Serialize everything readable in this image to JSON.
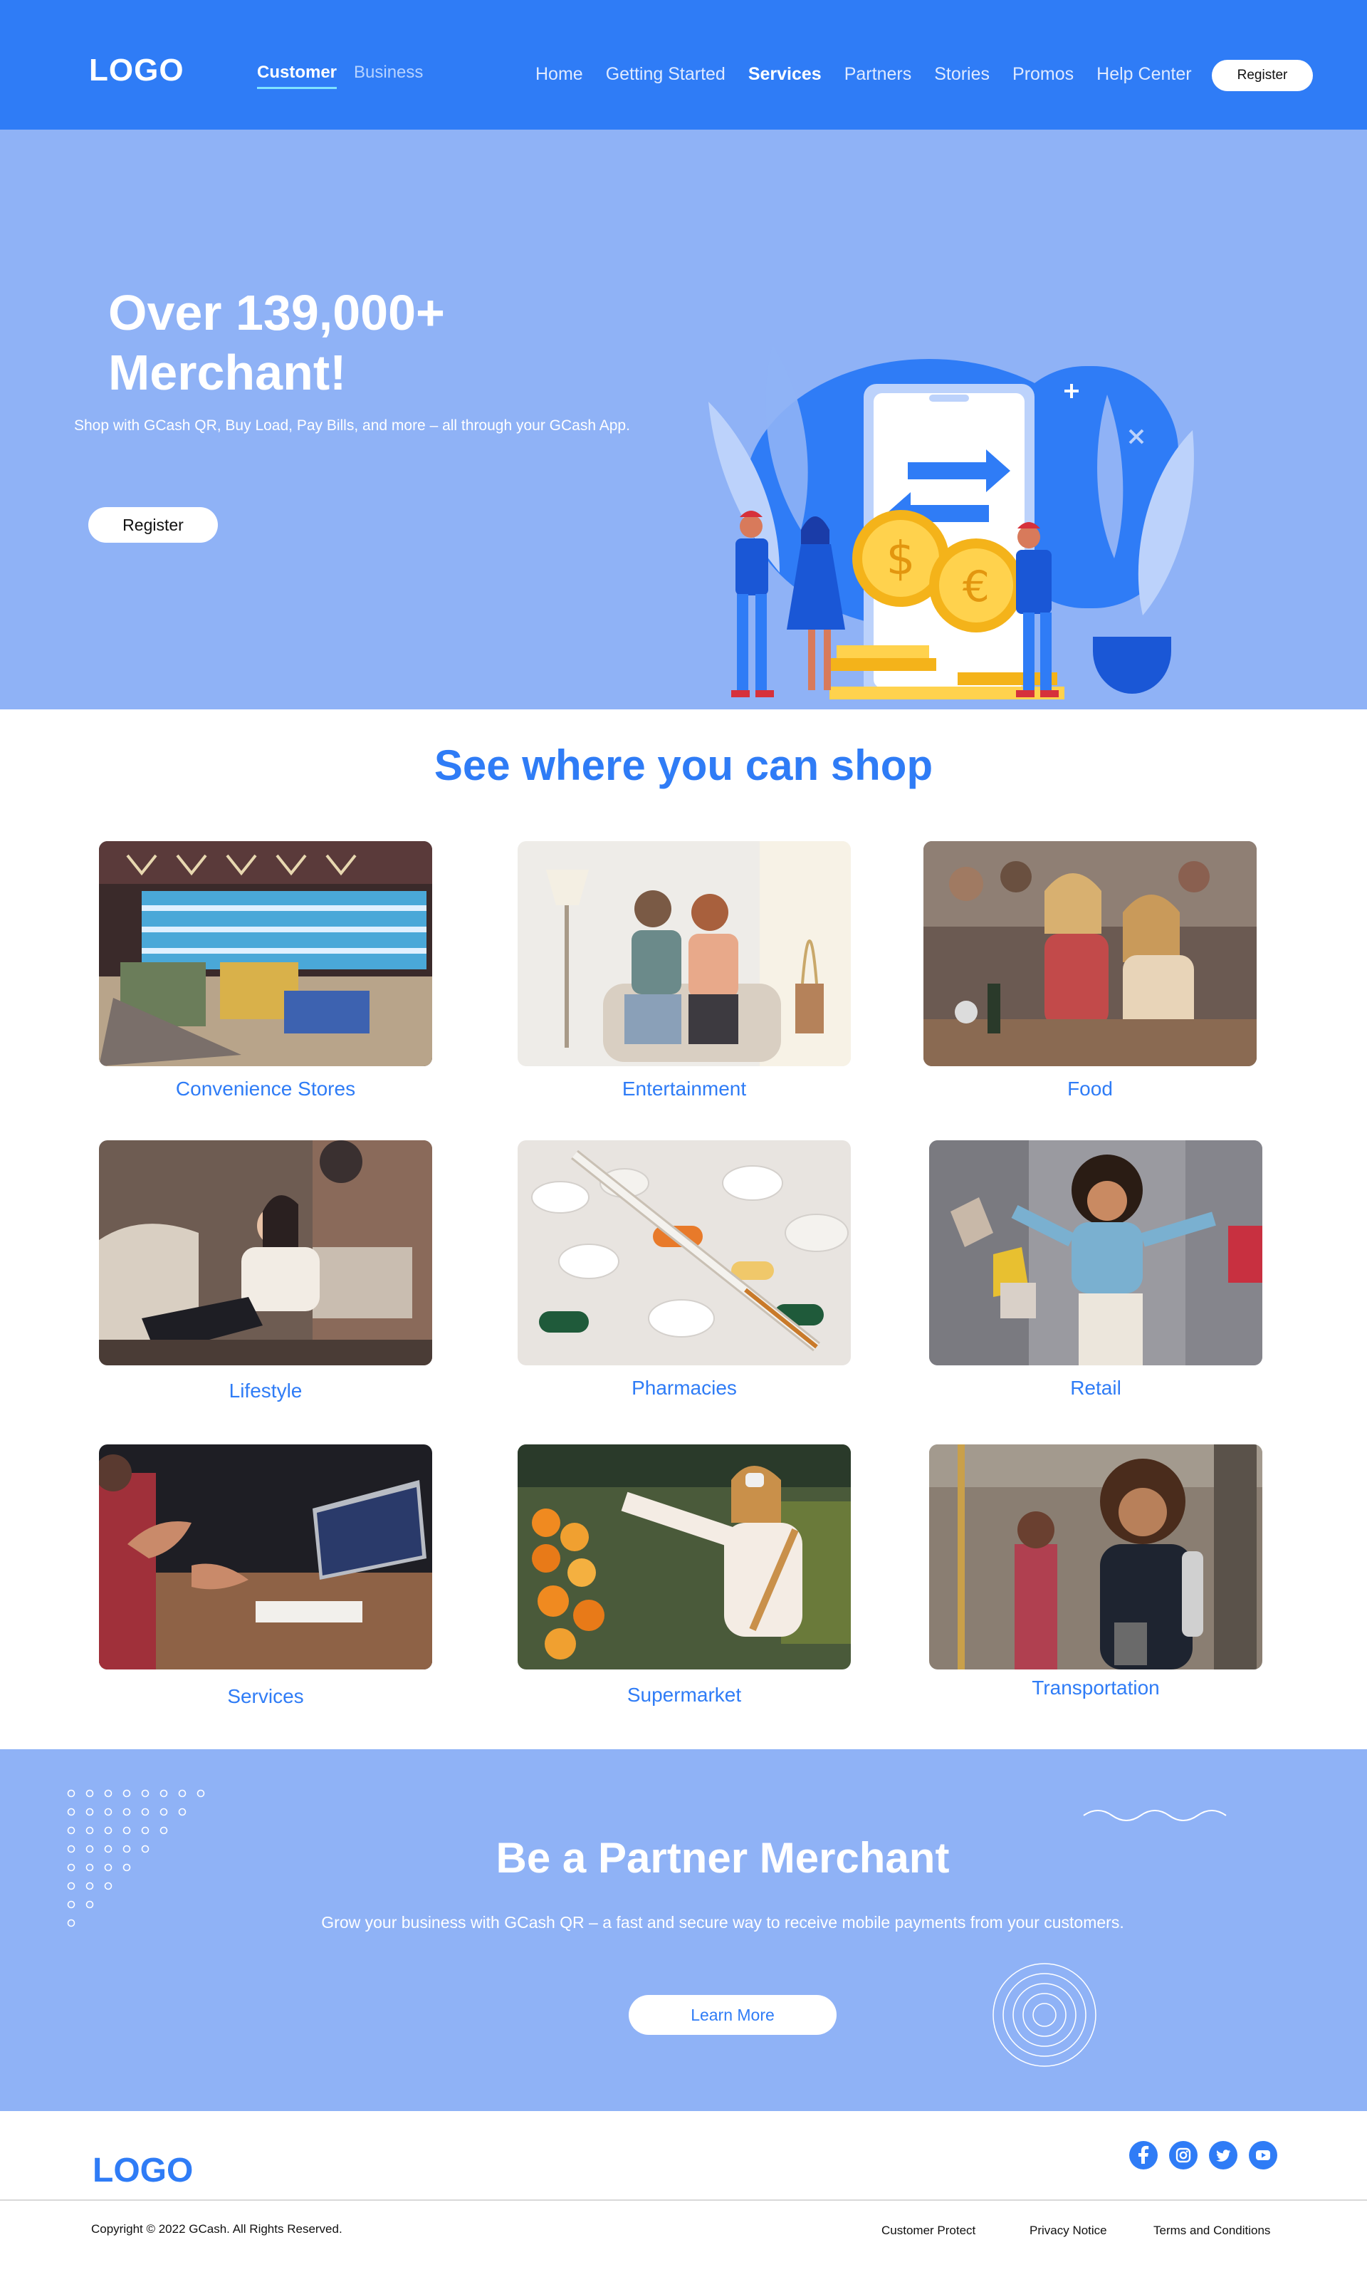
{
  "header": {
    "logo": "LOGO",
    "audience_tabs": [
      "Customer",
      "Business"
    ],
    "nav": [
      "Home",
      "Getting Started",
      "Services",
      "Partners",
      "Stories",
      "Promos",
      "Help Center"
    ],
    "active_nav": "Services",
    "register_label": "Register"
  },
  "hero": {
    "title": "Over 139,000+ Merchant!",
    "subtitle": "Shop with GCash QR, Buy Load, Pay Bills, and more – all through your GCash App.",
    "register_label": "Register"
  },
  "shop": {
    "title": "See where you can shop",
    "categories": [
      "Convenience Stores",
      "Entertainment",
      "Food",
      "Lifestyle",
      "Pharmacies",
      "Retail",
      "Services",
      "Supermarket",
      "Transportation"
    ]
  },
  "partner": {
    "title": "Be a Partner Merchant",
    "subtitle": "Grow your business with GCash QR – a fast and secure way to receive mobile payments from your customers.",
    "button_label": "Learn More"
  },
  "footer": {
    "logo": "LOGO",
    "socials": [
      "facebook-icon",
      "instagram-icon",
      "twitter-icon",
      "youtube-icon"
    ],
    "copyright": "Copyright © 2022 GCash. All Rights Reserved.",
    "links": [
      "Customer Protect",
      "Privacy Notice",
      "Terms and Conditions"
    ]
  },
  "colors": {
    "brand_blue": "#2f7cf6",
    "light_blue": "#8fb2f6"
  }
}
